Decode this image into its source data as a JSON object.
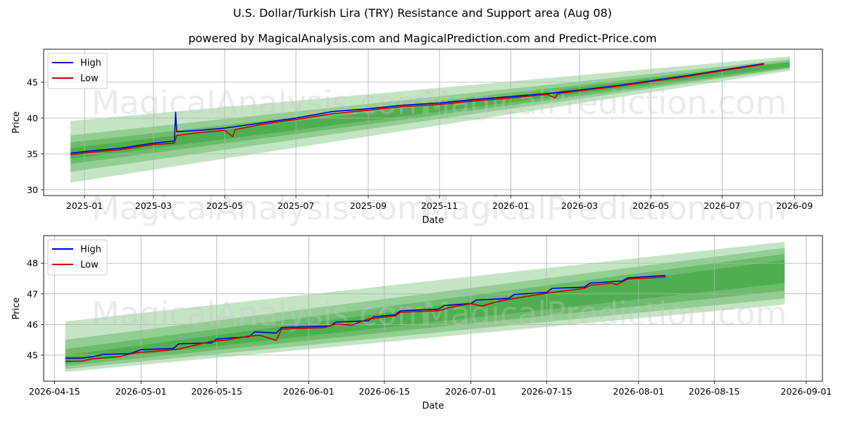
{
  "title": "U.S. Dollar/Turkish Lira (TRY) Resistance and Support area (Aug 08)",
  "subtitle": "powered by MagicalAnalysis.com and MagicalPrediction.com and Predict-Price.com",
  "watermark": [
    "MagicalAnalysis.com",
    "MagicalPrediction.com"
  ],
  "colors": {
    "high": "#0000cc",
    "low": "#cc0000",
    "band": "#2ca02c",
    "grid": "#b0b0b0"
  },
  "chart_data": [
    {
      "type": "line",
      "xlabel": "Date",
      "ylabel": "Price",
      "grid": true,
      "legend": "top-left",
      "xlim": [
        "2024-11-27",
        "2026-09-25"
      ],
      "ylim": [
        29.2,
        49.6
      ],
      "xticks": [
        "2025-01",
        "2025-03",
        "2025-05",
        "2025-07",
        "2025-09",
        "2025-11",
        "2026-01",
        "2026-03",
        "2026-05",
        "2026-07",
        "2026-09"
      ],
      "yticks": [
        30,
        35,
        40,
        45
      ],
      "band_range": [
        "2024-12-20",
        "2026-08-28"
      ],
      "bands": [
        {
          "start": [
            31.0,
            39.6
          ],
          "end": [
            46.6,
            48.6
          ],
          "opacity": 0.28
        },
        {
          "start": [
            32.5,
            37.6
          ],
          "end": [
            46.9,
            48.2
          ],
          "opacity": 0.32
        },
        {
          "start": [
            33.6,
            36.6
          ],
          "end": [
            47.0,
            47.9
          ],
          "opacity": 0.38
        },
        {
          "start": [
            34.3,
            35.8
          ],
          "end": [
            47.2,
            47.8
          ],
          "opacity": 0.45
        }
      ],
      "series": [
        {
          "name": "High",
          "x": [
            "2024-12-20",
            "2025-01-05",
            "2025-02-01",
            "2025-03-01",
            "2025-03-19",
            "2025-03-20",
            "2025-03-21",
            "2025-04-10",
            "2025-05-01",
            "2025-06-01",
            "2025-07-01",
            "2025-08-01",
            "2025-09-01",
            "2025-10-01",
            "2025-11-01",
            "2025-12-01",
            "2026-01-01",
            "2026-02-01",
            "2026-03-01",
            "2026-04-01",
            "2026-05-01",
            "2026-06-01",
            "2026-07-01",
            "2026-08-06"
          ],
          "values": [
            35.1,
            35.4,
            35.8,
            36.5,
            36.8,
            40.8,
            38.1,
            38.3,
            38.6,
            39.3,
            40.0,
            40.9,
            41.3,
            41.8,
            42.1,
            42.6,
            43.0,
            43.4,
            43.9,
            44.5,
            45.2,
            45.9,
            46.7,
            47.6
          ]
        },
        {
          "name": "Low",
          "x": [
            "2024-12-20",
            "2025-01-05",
            "2025-02-01",
            "2025-03-01",
            "2025-03-19",
            "2025-03-21",
            "2025-04-10",
            "2025-05-01",
            "2025-05-08",
            "2025-05-10",
            "2025-06-01",
            "2025-07-01",
            "2025-08-01",
            "2025-09-01",
            "2025-10-01",
            "2025-11-01",
            "2025-12-01",
            "2026-01-01",
            "2026-02-01",
            "2026-02-08",
            "2026-02-10",
            "2026-03-01",
            "2026-04-01",
            "2026-05-01",
            "2026-06-01",
            "2026-07-01",
            "2026-08-06"
          ],
          "values": [
            34.9,
            35.2,
            35.6,
            36.3,
            36.5,
            37.6,
            38.0,
            38.3,
            37.4,
            38.4,
            39.1,
            39.8,
            40.6,
            41.1,
            41.6,
            41.9,
            42.4,
            42.8,
            43.3,
            42.8,
            43.4,
            43.8,
            44.4,
            45.1,
            45.8,
            46.6,
            47.5
          ]
        }
      ]
    },
    {
      "type": "line",
      "xlabel": "Date",
      "ylabel": "Price",
      "grid": true,
      "legend": "top-left",
      "xlim": [
        "2026-04-13",
        "2026-09-04"
      ],
      "ylim": [
        44.15,
        48.9
      ],
      "xticks": [
        "2026-04-15",
        "2026-05-01",
        "2026-05-15",
        "2026-06-01",
        "2026-06-15",
        "2026-07-01",
        "2026-07-15",
        "2026-08-01",
        "2026-08-15",
        "2026-09-01"
      ],
      "yticks": [
        45,
        46,
        47,
        48
      ],
      "band_range": [
        "2026-04-17",
        "2026-08-28"
      ],
      "bands": [
        {
          "start": [
            44.45,
            46.1
          ],
          "end": [
            46.65,
            48.7
          ],
          "opacity": 0.28
        },
        {
          "start": [
            44.55,
            45.5
          ],
          "end": [
            46.85,
            48.5
          ],
          "opacity": 0.32
        },
        {
          "start": [
            44.65,
            45.2
          ],
          "end": [
            47.1,
            48.3
          ],
          "opacity": 0.38
        },
        {
          "start": [
            44.75,
            45.0
          ],
          "end": [
            47.35,
            48.1
          ],
          "opacity": 0.45
        }
      ],
      "series": [
        {
          "name": "High",
          "x": [
            "2026-04-17",
            "2026-04-20",
            "2026-04-22",
            "2026-04-24",
            "2026-04-29",
            "2026-05-01",
            "2026-05-07",
            "2026-05-08",
            "2026-05-14",
            "2026-05-15",
            "2026-05-21",
            "2026-05-22",
            "2026-05-26",
            "2026-05-27",
            "2026-06-05",
            "2026-06-06",
            "2026-06-12",
            "2026-06-13",
            "2026-06-17",
            "2026-06-18",
            "2026-06-25",
            "2026-06-26",
            "2026-07-01",
            "2026-07-02",
            "2026-07-08",
            "2026-07-09",
            "2026-07-15",
            "2026-07-16",
            "2026-07-22",
            "2026-07-23",
            "2026-07-29",
            "2026-07-30",
            "2026-08-06"
          ],
          "values": [
            44.9,
            44.9,
            44.95,
            45.02,
            45.05,
            45.18,
            45.22,
            45.37,
            45.4,
            45.53,
            45.6,
            45.76,
            45.72,
            45.9,
            45.95,
            46.08,
            46.12,
            46.25,
            46.32,
            46.45,
            46.5,
            46.62,
            46.68,
            46.8,
            46.85,
            46.98,
            47.05,
            47.18,
            47.22,
            47.35,
            47.42,
            47.52,
            47.6
          ]
        },
        {
          "name": "Low",
          "x": [
            "2026-04-17",
            "2026-04-20",
            "2026-04-22",
            "2026-04-27",
            "2026-04-30",
            "2026-05-05",
            "2026-05-08",
            "2026-05-14",
            "2026-05-17",
            "2026-05-21",
            "2026-05-23",
            "2026-05-26",
            "2026-05-27",
            "2026-06-04",
            "2026-06-06",
            "2026-06-09",
            "2026-06-12",
            "2026-06-17",
            "2026-06-18",
            "2026-06-25",
            "2026-06-27",
            "2026-07-01",
            "2026-07-03",
            "2026-07-06",
            "2026-07-09",
            "2026-07-15",
            "2026-07-22",
            "2026-07-23",
            "2026-07-27",
            "2026-07-28",
            "2026-07-30",
            "2026-08-06"
          ],
          "values": [
            44.8,
            44.8,
            44.88,
            44.95,
            45.08,
            45.15,
            45.2,
            45.45,
            45.5,
            45.62,
            45.65,
            45.48,
            45.85,
            45.9,
            46.02,
            45.98,
            46.18,
            46.28,
            46.4,
            46.45,
            46.55,
            46.68,
            46.6,
            46.75,
            46.85,
            47.02,
            47.18,
            47.28,
            47.35,
            47.3,
            47.48,
            47.55
          ]
        }
      ]
    }
  ]
}
